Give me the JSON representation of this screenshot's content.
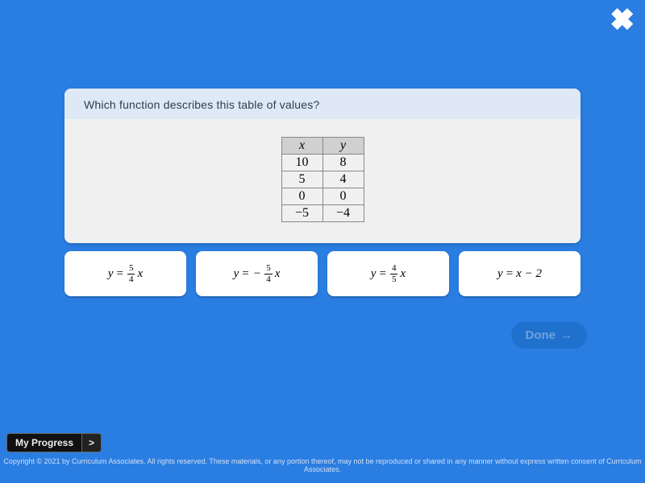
{
  "question": "Which function describes this table of values?",
  "table": {
    "headers": [
      "x",
      "y"
    ],
    "rows": [
      [
        "10",
        "8"
      ],
      [
        "5",
        "4"
      ],
      [
        "0",
        "0"
      ],
      [
        "−5",
        "−4"
      ]
    ]
  },
  "options": [
    {
      "id": "opt-a",
      "prefix": "y",
      "eq": "=",
      "neg": false,
      "frac": {
        "num": "5",
        "den": "4"
      },
      "trailing_var": "x"
    },
    {
      "id": "opt-b",
      "prefix": "y",
      "eq": "=",
      "neg": true,
      "frac": {
        "num": "5",
        "den": "4"
      },
      "trailing_var": "x"
    },
    {
      "id": "opt-c",
      "prefix": "y",
      "eq": "=",
      "neg": false,
      "frac": {
        "num": "4",
        "den": "5"
      },
      "trailing_var": "x"
    },
    {
      "id": "opt-d",
      "prefix": "y",
      "eq": "=",
      "plain": "x − 2"
    }
  ],
  "done_label": "Done",
  "progress_label": "My Progress",
  "progress_arrow": ">",
  "copyright": "Copyright © 2021 by Curriculum Associates. All rights reserved. These materials, or any portion thereof, may not be reproduced or shared in any manner without express written consent of Curriculum Associates."
}
